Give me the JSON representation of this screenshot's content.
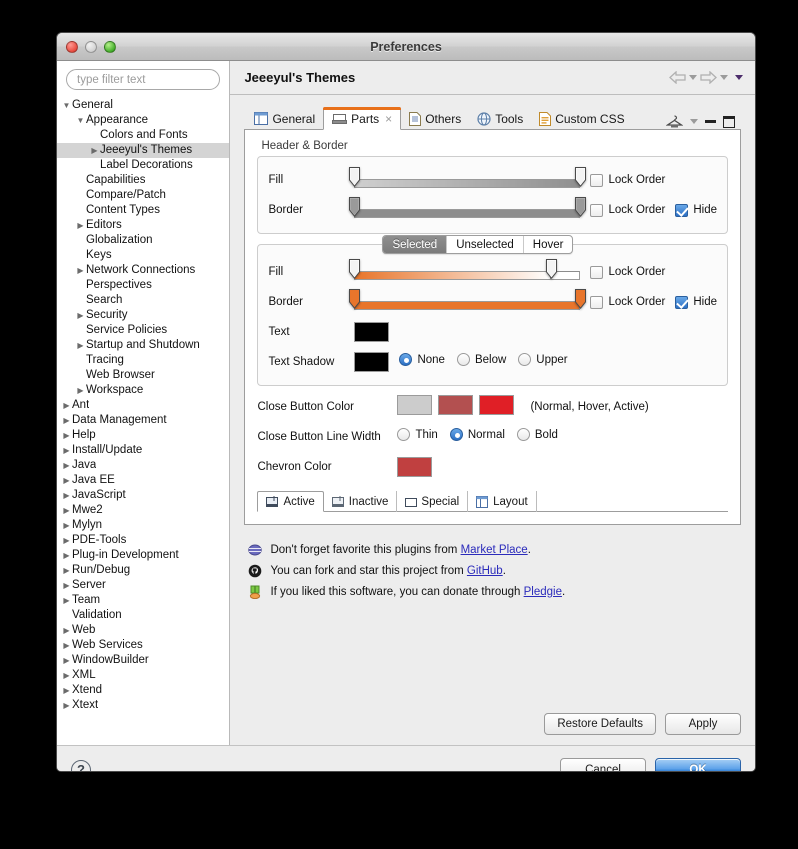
{
  "window": {
    "title": "Preferences"
  },
  "sidebar": {
    "filter": {
      "placeholder": "type filter text",
      "value": ""
    },
    "items": [
      {
        "label": "General",
        "indent": 0,
        "twisty": "down",
        "selected": false
      },
      {
        "label": "Appearance",
        "indent": 1,
        "twisty": "down",
        "selected": false
      },
      {
        "label": "Colors and Fonts",
        "indent": 2,
        "twisty": "none",
        "selected": false
      },
      {
        "label": "Jeeeyul's Themes",
        "indent": 2,
        "twisty": "right",
        "selected": true
      },
      {
        "label": "Label Decorations",
        "indent": 2,
        "twisty": "none",
        "selected": false
      },
      {
        "label": "Capabilities",
        "indent": 1,
        "twisty": "none",
        "selected": false
      },
      {
        "label": "Compare/Patch",
        "indent": 1,
        "twisty": "none",
        "selected": false
      },
      {
        "label": "Content Types",
        "indent": 1,
        "twisty": "none",
        "selected": false
      },
      {
        "label": "Editors",
        "indent": 1,
        "twisty": "right",
        "selected": false
      },
      {
        "label": "Globalization",
        "indent": 1,
        "twisty": "none",
        "selected": false
      },
      {
        "label": "Keys",
        "indent": 1,
        "twisty": "none",
        "selected": false
      },
      {
        "label": "Network Connections",
        "indent": 1,
        "twisty": "right",
        "selected": false
      },
      {
        "label": "Perspectives",
        "indent": 1,
        "twisty": "none",
        "selected": false
      },
      {
        "label": "Search",
        "indent": 1,
        "twisty": "none",
        "selected": false
      },
      {
        "label": "Security",
        "indent": 1,
        "twisty": "right",
        "selected": false
      },
      {
        "label": "Service Policies",
        "indent": 1,
        "twisty": "none",
        "selected": false
      },
      {
        "label": "Startup and Shutdown",
        "indent": 1,
        "twisty": "right",
        "selected": false
      },
      {
        "label": "Tracing",
        "indent": 1,
        "twisty": "none",
        "selected": false
      },
      {
        "label": "Web Browser",
        "indent": 1,
        "twisty": "none",
        "selected": false
      },
      {
        "label": "Workspace",
        "indent": 1,
        "twisty": "right",
        "selected": false
      },
      {
        "label": "Ant",
        "indent": 0,
        "twisty": "right",
        "selected": false
      },
      {
        "label": "Data Management",
        "indent": 0,
        "twisty": "right",
        "selected": false
      },
      {
        "label": "Help",
        "indent": 0,
        "twisty": "right",
        "selected": false
      },
      {
        "label": "Install/Update",
        "indent": 0,
        "twisty": "right",
        "selected": false
      },
      {
        "label": "Java",
        "indent": 0,
        "twisty": "right",
        "selected": false
      },
      {
        "label": "Java EE",
        "indent": 0,
        "twisty": "right",
        "selected": false
      },
      {
        "label": "JavaScript",
        "indent": 0,
        "twisty": "right",
        "selected": false
      },
      {
        "label": "Mwe2",
        "indent": 0,
        "twisty": "right",
        "selected": false
      },
      {
        "label": "Mylyn",
        "indent": 0,
        "twisty": "right",
        "selected": false
      },
      {
        "label": "PDE-Tools",
        "indent": 0,
        "twisty": "right",
        "selected": false
      },
      {
        "label": "Plug-in Development",
        "indent": 0,
        "twisty": "right",
        "selected": false
      },
      {
        "label": "Run/Debug",
        "indent": 0,
        "twisty": "right",
        "selected": false
      },
      {
        "label": "Server",
        "indent": 0,
        "twisty": "right",
        "selected": false
      },
      {
        "label": "Team",
        "indent": 0,
        "twisty": "right",
        "selected": false
      },
      {
        "label": "Validation",
        "indent": 0,
        "twisty": "none",
        "selected": false
      },
      {
        "label": "Web",
        "indent": 0,
        "twisty": "right",
        "selected": false
      },
      {
        "label": "Web Services",
        "indent": 0,
        "twisty": "right",
        "selected": false
      },
      {
        "label": "WindowBuilder",
        "indent": 0,
        "twisty": "right",
        "selected": false
      },
      {
        "label": "XML",
        "indent": 0,
        "twisty": "right",
        "selected": false
      },
      {
        "label": "Xtend",
        "indent": 0,
        "twisty": "right",
        "selected": false
      },
      {
        "label": "Xtext",
        "indent": 0,
        "twisty": "right",
        "selected": false
      }
    ]
  },
  "page": {
    "title": "Jeeeyul's Themes",
    "nav": {
      "back": "back-arrow",
      "forward": "forward-arrow",
      "menu": "view-menu"
    }
  },
  "tabs": {
    "items": [
      {
        "label": "General",
        "icon": "layout-icon",
        "active": false,
        "closable": false
      },
      {
        "label": "Parts",
        "icon": "parts-icon",
        "active": true,
        "closable": true
      },
      {
        "label": "Others",
        "icon": "document-icon",
        "active": false,
        "closable": false
      },
      {
        "label": "Tools",
        "icon": "globe-icon",
        "active": false,
        "closable": false
      },
      {
        "label": "Custom CSS",
        "icon": "css-file-icon",
        "active": false,
        "closable": false
      }
    ],
    "close_glyph": "×",
    "tools": {
      "theme": "hanger-icon",
      "minimize": "minimize-icon",
      "maximize": "maximize-icon"
    }
  },
  "parts": {
    "header_group_label": "Header & Border",
    "header": {
      "rows": [
        {
          "label": "Fill",
          "type": "gradient",
          "start_pct": 0,
          "end_pct": 100,
          "bar_color": "#cfcfcf",
          "bar_color2": "#8f8f8f",
          "handle_style": "light",
          "lock_order": {
            "label": "Lock Order",
            "checked": false
          },
          "hide": null
        },
        {
          "label": "Border",
          "type": "gradient",
          "start_pct": 0,
          "end_pct": 100,
          "bar_color": "#8d8d8d",
          "bar_color2": "#8d8d8d",
          "handle_style": "dark",
          "lock_order": {
            "label": "Lock Order",
            "checked": false
          },
          "hide": {
            "label": "Hide",
            "checked": true
          }
        }
      ]
    },
    "states": {
      "options": [
        "Selected",
        "Unselected",
        "Hover"
      ],
      "selected": "Selected"
    },
    "state_rows": [
      {
        "label": "Fill",
        "type": "gradient",
        "start_pct": 0,
        "end_pct": 87,
        "bar_color": "#e8752b",
        "bar_color2": "#ffffff",
        "handle_style": "light",
        "lock_order": {
          "label": "Lock Order",
          "checked": false
        },
        "hide": null
      },
      {
        "label": "Border",
        "type": "gradient",
        "start_pct": 0,
        "end_pct": 100,
        "bar_color": "#e8752b",
        "bar_color2": "#e8752b",
        "handle_style": "orange",
        "lock_order": {
          "label": "Lock Order",
          "checked": false
        },
        "hide": {
          "label": "Hide",
          "checked": true
        }
      }
    ],
    "text": {
      "label": "Text",
      "color": "#000000"
    },
    "text_shadow": {
      "label": "Text Shadow",
      "color": "#000000",
      "options": [
        "None",
        "Below",
        "Upper"
      ],
      "selected": "None"
    },
    "close_button_color": {
      "label": "Close Button Color",
      "colors": [
        "#cccccc",
        "#b35050",
        "#e01f26"
      ],
      "note": "(Normal, Hover, Active)"
    },
    "close_button_line_width": {
      "label": "Close Button Line Width",
      "options": [
        "Thin",
        "Normal",
        "Bold"
      ],
      "selected": "Normal"
    },
    "chevron_color": {
      "label": "Chevron Color",
      "color": "#c04040"
    },
    "mini_tabs": [
      {
        "label": "Active",
        "icon": "active-part-icon",
        "active": true
      },
      {
        "label": "Inactive",
        "icon": "inactive-part-icon",
        "active": false
      },
      {
        "label": "Special",
        "icon": "special-part-icon",
        "active": false
      },
      {
        "label": "Layout",
        "icon": "layout-part-icon",
        "active": false
      }
    ]
  },
  "links": [
    {
      "icon": "marketplace-icon",
      "before": "Don't forget favorite this plugins from ",
      "link": "Market Place",
      "after": "."
    },
    {
      "icon": "github-icon",
      "before": "You can fork and star this project from ",
      "link": "GitHub",
      "after": "."
    },
    {
      "icon": "pledgie-icon",
      "before": "If you liked this software, you can donate through ",
      "link": "Pledgie",
      "after": "."
    }
  ],
  "buttons": {
    "restore_defaults": "Restore Defaults",
    "apply": "Apply",
    "cancel": "Cancel",
    "ok": "OK",
    "help": "?"
  },
  "colors": {
    "accent_orange": "#e8752b",
    "selection_blue": "#4e97e4",
    "link_blue": "#2b2bbb",
    "tree_selection": "#d4d4d4"
  }
}
